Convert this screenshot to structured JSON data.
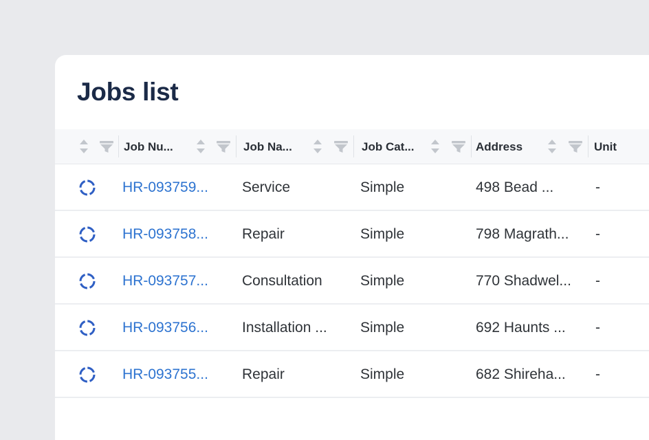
{
  "page": {
    "title": "Jobs list"
  },
  "table": {
    "columns": [
      {
        "label": ""
      },
      {
        "label": "Job Nu..."
      },
      {
        "label": "Job Na..."
      },
      {
        "label": "Job Cat..."
      },
      {
        "label": "Address"
      },
      {
        "label": "Unit"
      }
    ],
    "rows": [
      {
        "status_icon": "loading-spinner-icon",
        "job_number": "HR-093759...",
        "job_name": "Service",
        "job_category": "Simple",
        "address": "498 Bead ...",
        "unit": "-"
      },
      {
        "status_icon": "loading-spinner-icon",
        "job_number": "HR-093758...",
        "job_name": "Repair",
        "job_category": "Simple",
        "address": "798 Magrath...",
        "unit": "-"
      },
      {
        "status_icon": "loading-spinner-icon",
        "job_number": "HR-093757...",
        "job_name": "Consultation",
        "job_category": "Simple",
        "address": "770 Shadwel...",
        "unit": "-"
      },
      {
        "status_icon": "loading-spinner-icon",
        "job_number": "HR-093756...",
        "job_name": "Installation ...",
        "job_category": "Simple",
        "address": "692 Haunts ...",
        "unit": "-"
      },
      {
        "status_icon": "loading-spinner-icon",
        "job_number": "HR-093755...",
        "job_name": "Repair",
        "job_category": "Simple",
        "address": "682 Shireha...",
        "unit": "-"
      }
    ]
  },
  "colors": {
    "page_background": "#e9eaed",
    "card_background": "#ffffff",
    "title": "#1b2a47",
    "link": "#2d73d0",
    "status_icon": "#2f5fc4"
  }
}
